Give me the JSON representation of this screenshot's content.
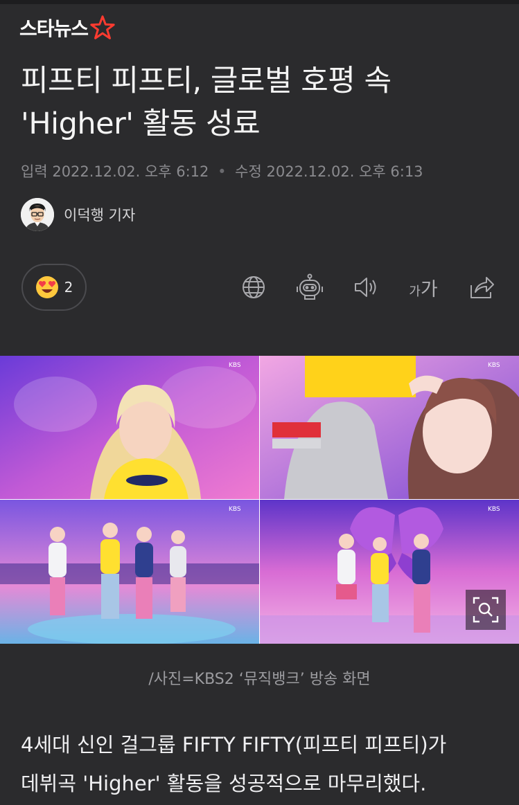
{
  "brand": {
    "name": "스타뉴스",
    "star_color": "#ff3b30"
  },
  "article": {
    "title_line1": "피프티 피프티, 글로벌 호평 속",
    "title_line2": "'Higher' 활동 성료",
    "input_label": "입력",
    "input_time": "2022.12.02. 오후 6:12",
    "separator_dot": "•",
    "modified_label": "수정",
    "modified_time": "2022.12.02. 오후 6:13",
    "reporter": "이덕행 기자"
  },
  "toolbar": {
    "reaction_icon": "heart-eyes-emoji-icon",
    "reaction_count": "2",
    "font_small": "가",
    "font_large": "가",
    "icons": [
      "globe-icon",
      "robot-icon",
      "speaker-icon",
      "font-size-icon",
      "share-icon"
    ]
  },
  "photo": {
    "caption": "/사진=KBS2 ‘뮤직뱅크’ 방송 화면",
    "broadcaster_mark": "KBS",
    "zoom_icon": "zoom-icon"
  },
  "body": {
    "line1": "4세대 신인 걸그룹 FIFTY FIFTY(피프티 피프티)가",
    "line2": "데뷔곡 'Higher' 활동을 성공적으로 마무리했다."
  }
}
